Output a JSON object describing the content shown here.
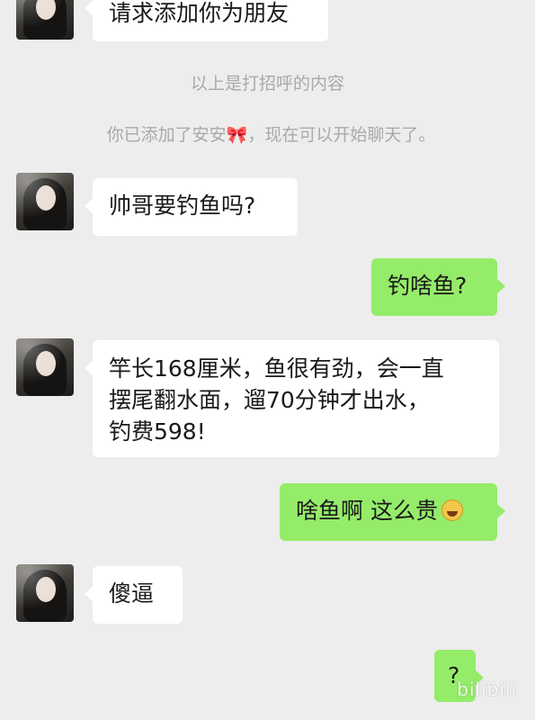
{
  "chat": {
    "messages": [
      {
        "side": "in",
        "text": "请求添加你为朋友"
      },
      {
        "side": "in",
        "text": "帅哥要钓鱼吗?"
      },
      {
        "side": "out",
        "text": "钓啥鱼?"
      },
      {
        "side": "in",
        "lines": [
          "竿长168厘米，鱼很有劲，会一直",
          "摆尾翻水面，遛70分钟才出水，",
          "钓费598!"
        ]
      },
      {
        "side": "out",
        "text": "啥鱼啊 这么贵"
      },
      {
        "side": "in",
        "text": "傻逼"
      },
      {
        "side": "out",
        "text": "?"
      }
    ],
    "system": {
      "greeting_note": "以上是打招呼的内容",
      "added_prefix": "你已添加了安安",
      "added_suffix": "，现在可以开始聊天了。"
    },
    "icons": [
      "bow-emoji-icon",
      "laughing-emoji-icon"
    ],
    "colors": {
      "background": "#ededed",
      "incoming": "#ffffff",
      "outgoing": "#95ec69",
      "system_text": "#a9a9a9"
    }
  },
  "watermark": {
    "text": "bilibili"
  }
}
